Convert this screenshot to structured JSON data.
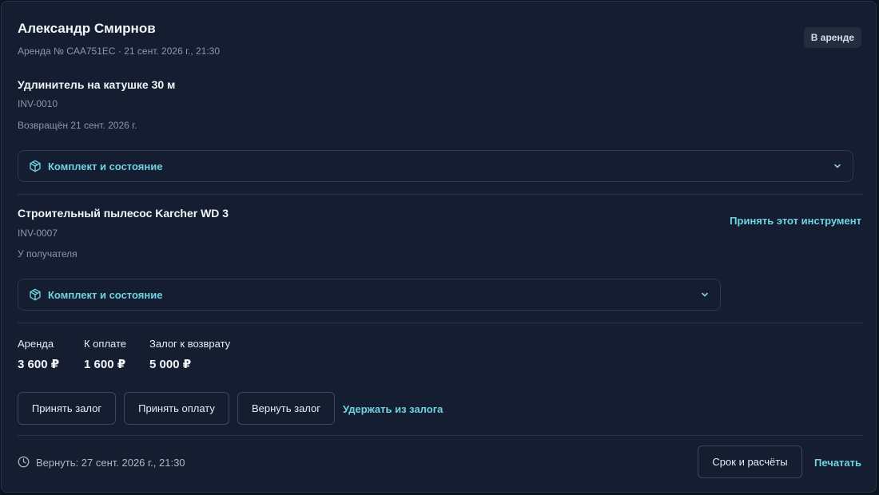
{
  "header": {
    "customer_name": "Александр Смирнов",
    "subtitle": "Аренда № CAA751EC · 21 сент. 2026 г., 21:30",
    "status_badge": "В аренде"
  },
  "items": [
    {
      "title": "Удлинитель на катушке 30 м",
      "inventory_id": "INV-0010",
      "status": "Возвращён 21 сент. 2026 г.",
      "accordion_label": "Комплект и состояние",
      "accordion_icon": "package-icon"
    },
    {
      "title": "Строительный пылесос Karcher WD 3",
      "inventory_id": "INV-0007",
      "status": "У получателя",
      "accordion_label": "Комплект и состояние",
      "accordion_icon": "package-icon",
      "action_link": "Принять этот инструмент"
    }
  ],
  "summary": {
    "rent": {
      "label": "Аренда",
      "value": "3 600 ₽"
    },
    "to_pay": {
      "label": "К оплате",
      "value": "1 600 ₽"
    },
    "deposit": {
      "label": "Залог к возврату",
      "value": "5 000 ₽"
    }
  },
  "actions": {
    "accept_deposit": "Принять залог",
    "accept_payment": "Принять оплату",
    "return_deposit": "Вернуть залог",
    "withhold_deposit": "Удержать из залога"
  },
  "footer": {
    "return_text": "Вернуть: 27 сент. 2026 г., 21:30",
    "clock_icon": "clock-icon",
    "term_button": "Срок и расчёты",
    "print_link": "Печатать"
  },
  "colors": {
    "background": "#141e30",
    "accent": "#6fd3e3",
    "muted_text": "#8b97aa",
    "border": "#2c394f"
  }
}
